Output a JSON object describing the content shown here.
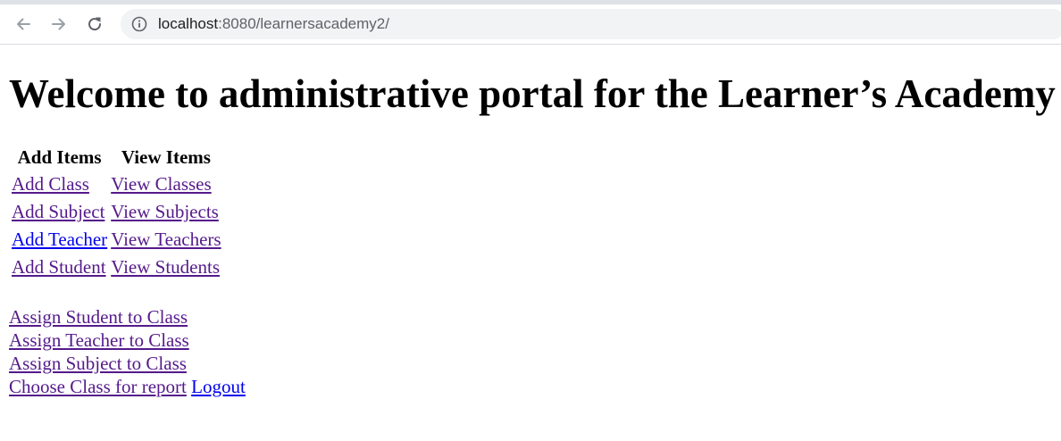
{
  "browser": {
    "url_host": "localhost",
    "url_rest": ":8080/learnersacademy2/"
  },
  "page": {
    "heading": "Welcome to administrative portal for the Learner’s Academy",
    "table": {
      "headers": [
        "Add Items",
        "View Items"
      ],
      "rows": [
        {
          "add": "Add Class",
          "view": "View Classes"
        },
        {
          "add": "Add Subject",
          "view": "View Subjects"
        },
        {
          "add": "Add Teacher",
          "view": "View Teachers"
        },
        {
          "add": "Add Student",
          "view": "View Students"
        }
      ]
    },
    "links": {
      "assign_student": "Assign Student to Class",
      "assign_teacher": "Assign Teacher to Class",
      "assign_subject": "Assign Subject to Class",
      "choose_class_report": "Choose Class for report",
      "logout": "Logout"
    }
  },
  "colors": {
    "visited_link": "#551a8b",
    "unvisited_link": "#0000ee",
    "toolbar_bg": "#ffffff",
    "omnibox_bg": "#f1f3f4"
  },
  "icons": {
    "back": "back-arrow-icon",
    "forward": "forward-arrow-icon",
    "reload": "reload-icon",
    "info": "info-icon"
  }
}
